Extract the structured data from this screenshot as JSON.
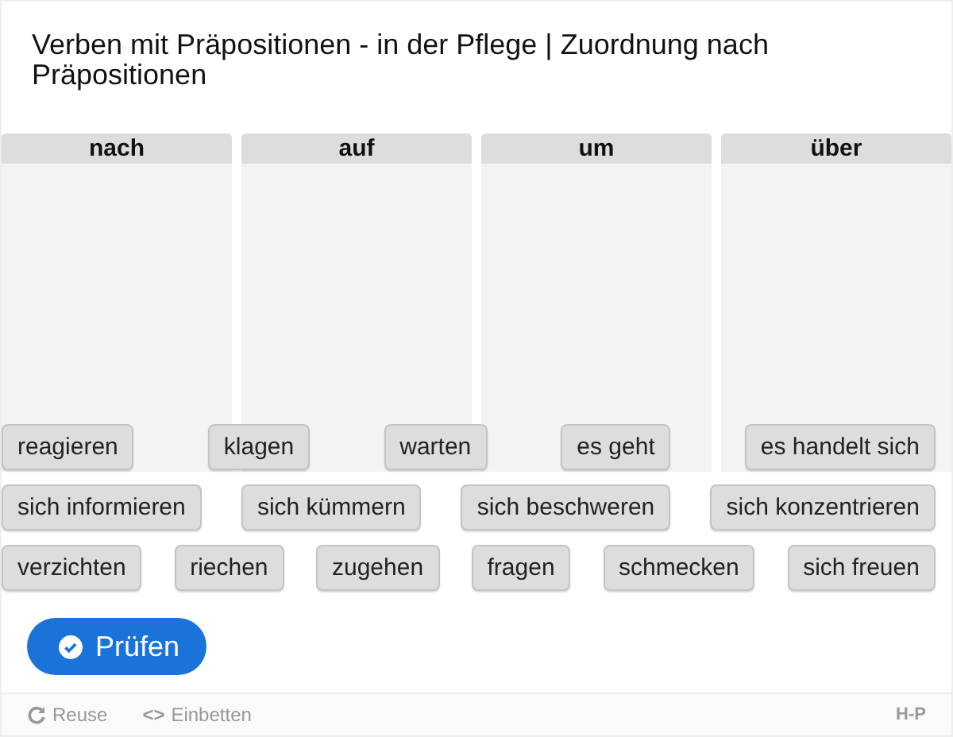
{
  "title": "Verben mit Präpositionen - in der Pflege | Zuordnung nach Präpositionen",
  "columns": [
    {
      "label": "nach"
    },
    {
      "label": "auf"
    },
    {
      "label": "um"
    },
    {
      "label": "über"
    }
  ],
  "word_rows": [
    [
      "reagieren",
      "klagen",
      "warten",
      "es geht",
      "es handelt sich"
    ],
    [
      "sich informieren",
      "sich kümmern",
      "sich beschweren",
      "sich konzentrieren"
    ],
    [
      "verzichten",
      "riechen",
      "zugehen",
      "fragen",
      "schmecken",
      "sich freuen"
    ]
  ],
  "check_button": {
    "label": "Prüfen"
  },
  "footer": {
    "reuse": "Reuse",
    "embed": "Einbetten",
    "embed_icon": "<>",
    "logo": "H-P"
  }
}
